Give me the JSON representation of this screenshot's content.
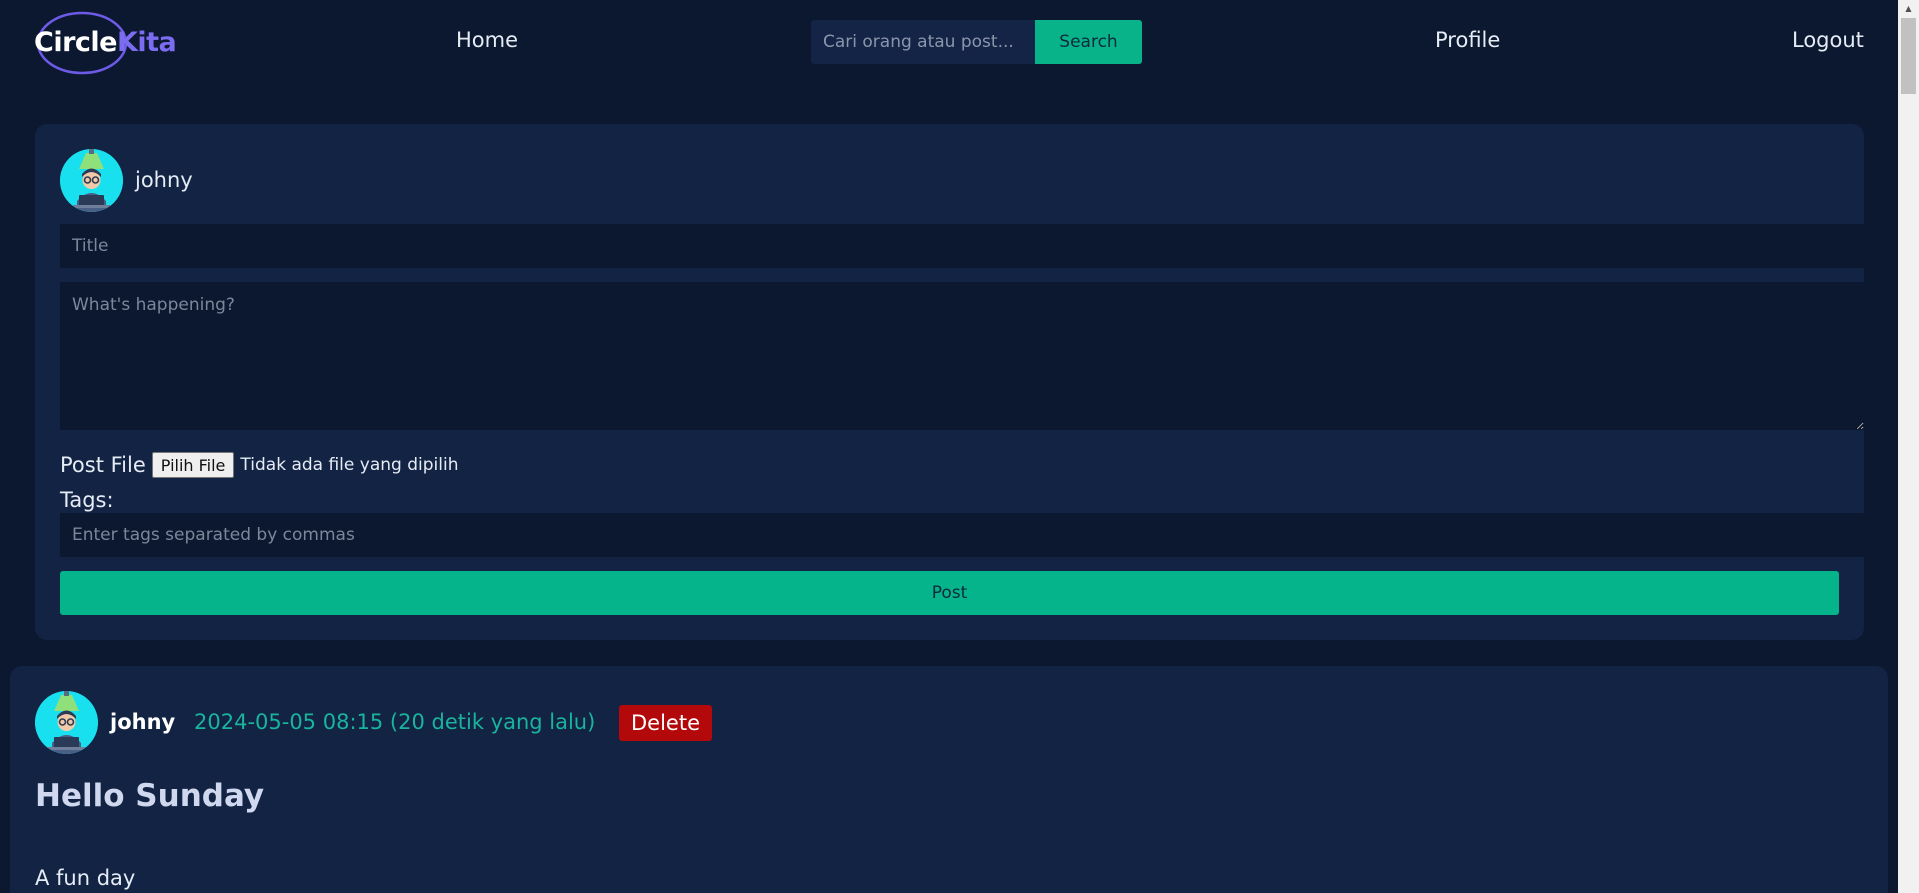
{
  "navbar": {
    "logo": {
      "part1": "Circle",
      "part2": "Kita"
    },
    "home_label": "Home",
    "search_placeholder": "Cari orang atau post...",
    "search_button": "Search",
    "profile_label": "Profile",
    "logout_label": "Logout"
  },
  "composer": {
    "username": "johny",
    "title_placeholder": "Title",
    "body_placeholder": "What's happening?",
    "file_label": "Post File",
    "file_button": "Pilih File",
    "file_status": "Tidak ada file yang dipilih",
    "tags_label": "Tags:",
    "tags_placeholder": "Enter tags separated by commas",
    "post_button": "Post"
  },
  "post": {
    "author": "johny",
    "timestamp": "2024-05-05 08:15 (20 detik yang lalu)",
    "delete_button": "Delete",
    "title": "Hello Sunday",
    "body": "A fun day"
  },
  "colors": {
    "background": "#0b1830",
    "card": "#122344",
    "accent": "#08b38a",
    "danger": "#b3090b",
    "logo_accent": "#7c6cf0",
    "avatar": "#18e0ef"
  }
}
